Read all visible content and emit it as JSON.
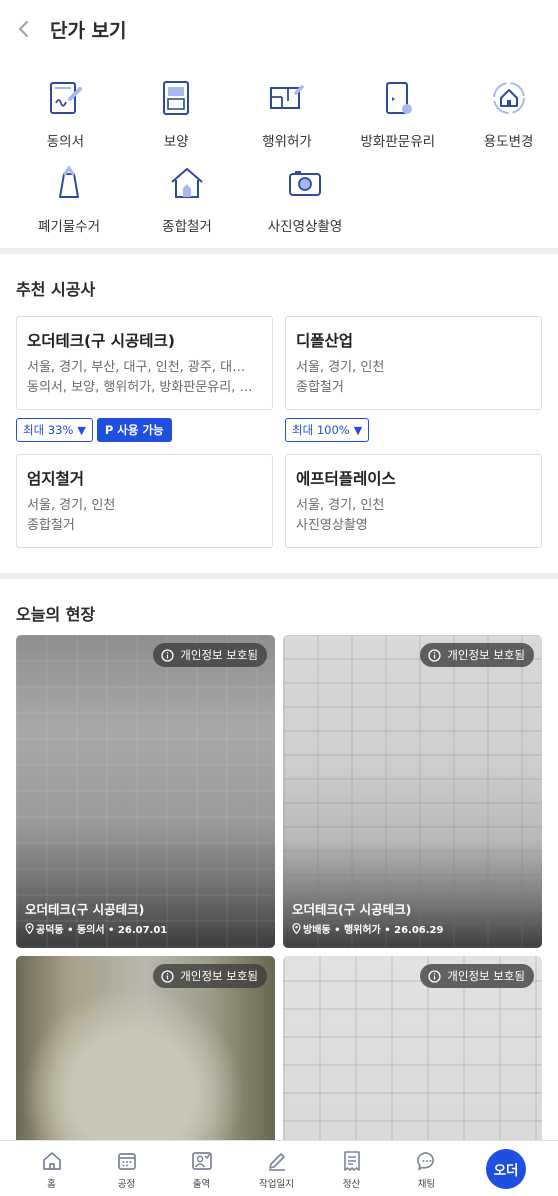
{
  "header": {
    "title": "단가 보기"
  },
  "services": [
    {
      "label": "동의서",
      "icon": "consent-form-icon"
    },
    {
      "label": "보양",
      "icon": "protection-door-icon"
    },
    {
      "label": "행위허가",
      "icon": "floorplan-permit-icon"
    },
    {
      "label": "방화판문유리",
      "icon": "fire-door-icon"
    },
    {
      "label": "용도변경",
      "icon": "house-change-icon"
    },
    {
      "label": "폐기물수거",
      "icon": "waste-bag-icon"
    },
    {
      "label": "종합철거",
      "icon": "demolition-house-icon"
    },
    {
      "label": "사진영상촬영",
      "icon": "camera-icon"
    }
  ],
  "recommended": {
    "title": "추천 시공사",
    "cards": [
      {
        "name": "오더테크(구 시공테크)",
        "regions": "서울, 경기, 부산, 대구, 인천, 광주, 대…",
        "services": "동의서, 보양, 행위허가, 방화판문유리, …"
      },
      {
        "name": "디폴산업",
        "regions": "서울, 경기, 인천",
        "services": "종합철거"
      },
      {
        "name": "엄지철거",
        "regions": "서울, 경기, 인천",
        "services": "종합철거"
      },
      {
        "name": "에프터플레이스",
        "regions": "서울, 경기, 인천",
        "services": "사진영상촬영"
      }
    ],
    "badges": {
      "card1_discount": "최대 33%",
      "card1_point": "P 사용 가능",
      "card2_discount": "최대 100%"
    }
  },
  "today": {
    "title": "오늘의 현장",
    "privacy_label": "개인정보 보호됨",
    "photos": [
      {
        "company": "오더테크(구 시공테크)",
        "meta": "공덕동 • 동의서 • 26.07.01"
      },
      {
        "company": "오더테크(구 시공테크)",
        "meta": "방배동 • 행위허가 • 26.06.29"
      },
      {
        "company": "",
        "meta": ""
      },
      {
        "company": "",
        "meta": ""
      }
    ]
  },
  "bottom_nav": {
    "items": [
      {
        "label": "홈",
        "icon": "home-icon"
      },
      {
        "label": "공정",
        "icon": "calendar-icon"
      },
      {
        "label": "출역",
        "icon": "attendance-icon"
      },
      {
        "label": "작업일지",
        "icon": "pencil-icon"
      },
      {
        "label": "정산",
        "icon": "receipt-icon"
      },
      {
        "label": "채팅",
        "icon": "chat-icon"
      }
    ],
    "order_button": "오더"
  },
  "colors": {
    "accent": "#1e4fe0",
    "icon_blue": "#2c4a9e",
    "icon_light": "#a8b8f2"
  }
}
